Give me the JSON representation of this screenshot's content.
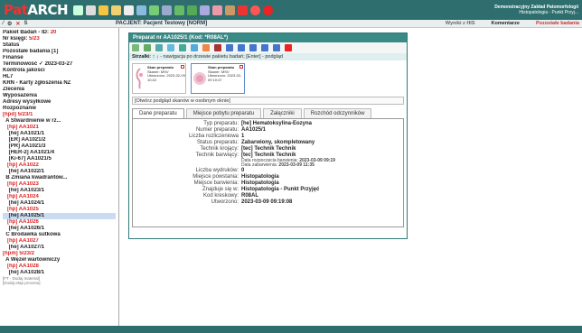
{
  "app": {
    "logo_pat": "Pat",
    "logo_arch": "ARCH"
  },
  "org": {
    "line1": "Demonstracyjny Zakład Patomorfologii",
    "line2": "Histopatologia - Punkt Przyj..."
  },
  "subbar": {
    "patient": "PACJENT: Pacjent Testowy [NORM]"
  },
  "nav": {
    "results_his": "Wyniki z HIS",
    "comments": "Komentarze",
    "remaining": "Pozostałe badania"
  },
  "sidebar": {
    "items": [
      {
        "text": "Pakiet Badań - ID: ",
        "num": "20",
        "cls": ""
      },
      {
        "text": "Nr księgi: ",
        "num": "5/23",
        "cls": ""
      },
      {
        "text": "Status",
        "num": "",
        "cls": ""
      },
      {
        "text": "Pozostałe badania [1]",
        "num": "",
        "cls": ""
      },
      {
        "text": "Finanse",
        "num": "",
        "cls": ""
      },
      {
        "text": "Terminowość ✓ 2023-03-27",
        "num": "",
        "cls": ""
      },
      {
        "text": "Kontrola jakości",
        "num": "",
        "cls": ""
      },
      {
        "text": "HL7",
        "num": "",
        "cls": ""
      },
      {
        "text": "KRN - Karty zgłoszenia NZ",
        "num": "",
        "cls": ""
      },
      {
        "text": "Zlecenia",
        "num": "",
        "cls": ""
      },
      {
        "text": "Wyposażenia",
        "num": "",
        "cls": ""
      },
      {
        "text": "Adresy wysyłkowe",
        "num": "",
        "cls": ""
      },
      {
        "text": "Rozpoznanie",
        "num": "",
        "cls": ""
      },
      {
        "text": "[hpd] 5/23/1",
        "num": "",
        "cls": "red"
      },
      {
        "text": "  A Stwardnienie w rz...",
        "num": "",
        "cls": ""
      },
      {
        "text": "   [hp] AA1021",
        "num": "",
        "cls": "red"
      },
      {
        "text": "    [he] AA1021/1",
        "num": "",
        "cls": ""
      },
      {
        "text": "    [ER] AA1021/2",
        "num": "",
        "cls": ""
      },
      {
        "text": "    [PR] AA1021/3",
        "num": "",
        "cls": ""
      },
      {
        "text": "    [HER-2] AA1021/4",
        "num": "",
        "cls": ""
      },
      {
        "text": "    [Ki-67] AA1021/5",
        "num": "",
        "cls": ""
      },
      {
        "text": "   [hp] AA1022",
        "num": "",
        "cls": "red"
      },
      {
        "text": "    [he] AA1022/1",
        "num": "",
        "cls": ""
      },
      {
        "text": "  B Zmiana kwadrantów...",
        "num": "",
        "cls": ""
      },
      {
        "text": "   [hp] AA1023",
        "num": "",
        "cls": "red"
      },
      {
        "text": "    [he] AA1023/1",
        "num": "",
        "cls": ""
      },
      {
        "text": "   [hp] AA1024",
        "num": "",
        "cls": "red"
      },
      {
        "text": "    [he] AA1024/1",
        "num": "",
        "cls": ""
      },
      {
        "text": "   [hp] AA1025",
        "num": "",
        "cls": "red"
      },
      {
        "text": "    [he] AA1025/1",
        "num": "",
        "cls": "sel"
      },
      {
        "text": "   [hp] AA1026",
        "num": "",
        "cls": "red"
      },
      {
        "text": "    [he] AA1026/1",
        "num": "",
        "cls": ""
      },
      {
        "text": "  C Brodawka sutkowa",
        "num": "",
        "cls": ""
      },
      {
        "text": "   [hp] AA1027",
        "num": "",
        "cls": "red"
      },
      {
        "text": "    [he] AA1027/1",
        "num": "",
        "cls": ""
      },
      {
        "text": "[hpm] 5/23/2",
        "num": "",
        "cls": "red"
      },
      {
        "text": "  A Węzeł wartowniczy",
        "num": "",
        "cls": ""
      },
      {
        "text": "   [hp] AA1028",
        "num": "",
        "cls": "red"
      },
      {
        "text": "    [he] AA1028/1",
        "num": "",
        "cls": ""
      },
      {
        "text": "[FT - Dodaj materiał]",
        "num": "",
        "cls": "small"
      },
      {
        "text": "[Dodaj etap procesu]",
        "num": "",
        "cls": "small"
      }
    ]
  },
  "panel": {
    "title": "Preparat nr AA1025/1 (Kod: *R08AL*)",
    "hint_label": "Strzałki",
    "hint_text": ": ↑ ↓ - nawigacja po drzewie pakietu badań; [Enter] - podgląd",
    "open_scan": "[Otwórz podgląd skanów w osobnym oknie]"
  },
  "scans": [
    {
      "title": "Skan preparatu",
      "scanner": "Skaner: MSV",
      "created": "Utworzono: 2023-02-09 10:42"
    },
    {
      "title": "Skan preparatu",
      "scanner": "Skaner: MSV",
      "created": "Utworzono: 2023-02-09 10:47"
    }
  ],
  "tabs": [
    "Dane preparatu",
    "Miejsce pobytu preparatu",
    "Załączniki",
    "Rozchód odczynników"
  ],
  "details": {
    "type_label": "Typ preparatu:",
    "type_val": "[he] Hematoksylina-Eozyna",
    "num_label": "Numer preparatu:",
    "num_val": "AA1025/1",
    "dup_label": "Liczba rozliczeniowa",
    "dup_val": "1",
    "status_label": "Status preparatu:",
    "status_val": "Zabarwiony, skompletowany",
    "cut_label": "Technik krojący:",
    "cut_val": "[tec] Technik Technik",
    "stain_label": "Technik barwiący:",
    "stain_val": "[tec] Technik Technik",
    "stain_start_label": "Data rozpoczęcia barwienia:",
    "stain_start_val": "2023-03-09 09:19",
    "stain_end_label": "Data zabarwienia:",
    "stain_end_val": "2023-03-09 11:35",
    "prints_label": "Liczba wydruków:",
    "prints_val": "0",
    "origin_label": "Miejsce powstania:",
    "origin_val": "Histopatologia",
    "staining_place_label": "Miejsce barwienia:",
    "staining_place_val": "Histopatologia",
    "location_label": "Znajduje się w:",
    "location_val": "Histopatologia - Punkt Przyjęć",
    "barcode_label": "Kod kreskowy:",
    "barcode_val": "R08AL",
    "created_label": "Utworzono:",
    "created_val": "2023-03-09 09:19:08"
  },
  "colors": {
    "header": "#2f6e6e",
    "panel_head": "#3a8a86",
    "alert": "#d22"
  }
}
